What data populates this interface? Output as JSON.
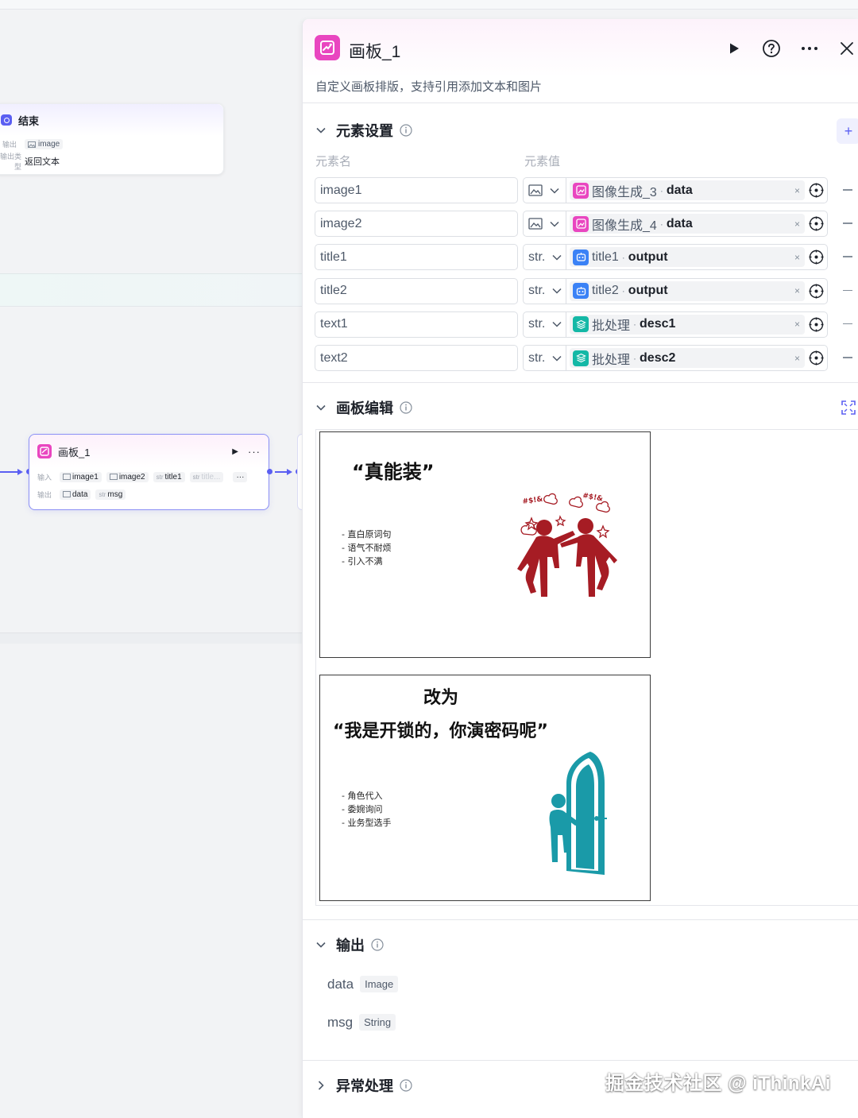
{
  "canvas": {
    "end_node": {
      "title": "结束",
      "output_label": "输出",
      "output_var": "image",
      "output_type_label": "输出类型",
      "output_type_value": "返回文本"
    },
    "board_node": {
      "title": "画板_1",
      "input_label": "输入",
      "inputs": [
        {
          "type": "img",
          "name": "image1"
        },
        {
          "type": "img",
          "name": "image2"
        },
        {
          "type": "str",
          "name": "title1"
        },
        {
          "type": "str",
          "name": "title..."
        }
      ],
      "more": "···",
      "output_label": "输出",
      "outputs": [
        {
          "type": "img",
          "name": "data"
        },
        {
          "type": "str",
          "name": "msg"
        }
      ]
    }
  },
  "panel": {
    "title": "画板_1",
    "description": "自定义画板排版，支持引用添加文本和图片",
    "icons": [
      "run-icon",
      "help-icon",
      "more-icon",
      "close-icon"
    ],
    "elements_section": {
      "title": "元素设置",
      "col_name": "元素名",
      "col_value": "元素值",
      "add": "+",
      "rows": [
        {
          "name": "image1",
          "type": "image",
          "ref_node": "图像生成_3",
          "ref_field": "data",
          "ref_icon": "image-gen",
          "ref_color": "#e946c0"
        },
        {
          "name": "image2",
          "type": "image",
          "ref_node": "图像生成_4",
          "ref_field": "data",
          "ref_icon": "image-gen",
          "ref_color": "#e946c0"
        },
        {
          "name": "title1",
          "type": "str.",
          "ref_node": "title1",
          "ref_field": "output",
          "ref_icon": "llm",
          "ref_color": "#3b82f6"
        },
        {
          "name": "title2",
          "type": "str.",
          "ref_node": "title2",
          "ref_field": "output",
          "ref_icon": "llm",
          "ref_color": "#3b82f6"
        },
        {
          "name": "text1",
          "type": "str.",
          "ref_node": "批处理",
          "ref_field": "desc1",
          "ref_icon": "batch",
          "ref_color": "#14b8a6"
        },
        {
          "name": "text2",
          "type": "str.",
          "ref_node": "批处理",
          "ref_field": "desc2",
          "ref_icon": "batch",
          "ref_color": "#14b8a6"
        }
      ]
    },
    "board_section": {
      "title": "画板编辑",
      "slide1": {
        "title": "“真能装”",
        "bullets": [
          "- 直白原词句",
          "- 语气不耐烦",
          "- 引入不满"
        ],
        "curse1": "#$!&",
        "curse2": "#$!&"
      },
      "slide2": {
        "title_line1": "改为",
        "title_line2": "“我是开锁的，你演密码呢”",
        "bullets": [
          "- 角色代入",
          "- 委婉询问",
          "- 业务型选手"
        ]
      }
    },
    "output_section": {
      "title": "输出",
      "items": [
        {
          "name": "data",
          "type": "Image"
        },
        {
          "name": "msg",
          "type": "String"
        }
      ]
    },
    "error_section": {
      "title": "异常处理"
    }
  },
  "watermark": "掘金技术社区 @ iThinkAi",
  "colors": {
    "accent": "#5b5ff2",
    "board_icon": "#e946c0",
    "llm_icon": "#3b82f6",
    "batch_icon": "#14b8a6",
    "figure_red": "#a61c24",
    "figure_teal": "#1a9aa8"
  }
}
